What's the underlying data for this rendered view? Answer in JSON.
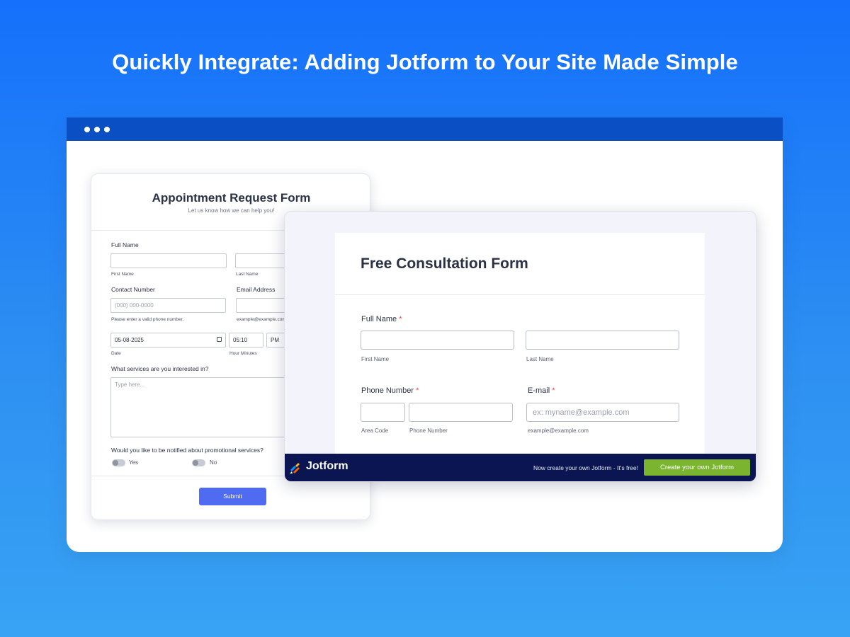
{
  "headline": "Quickly Integrate: Adding Jotform to Your Site Made Simple",
  "appointment_form": {
    "title": "Appointment Request Form",
    "subtitle": "Let us know how we can help you!",
    "full_name_label": "Full Name",
    "first_name_sub": "First Name",
    "last_name_sub": "Last Name",
    "contact_label": "Contact Number",
    "phone_placeholder": "(000) 000-0000",
    "phone_hint": "Please enter a valid phone number.",
    "email_label": "Email Address",
    "email_hint": "example@example.com",
    "date_value": "05-08-2025",
    "date_sub": "Date",
    "time_value": "05:10",
    "ampm_value": "PM",
    "time_sub": "Hour Minutes",
    "services_label": "What services are you interested in?",
    "services_placeholder": "Type here...",
    "promo_label": "Would you like to be notified about promotional services?",
    "yes_label": "Yes",
    "no_label": "No",
    "submit_label": "Submit"
  },
  "consultation_form": {
    "title": "Free Consultation Form",
    "full_name_label": "Full Name",
    "first_name_sub": "First Name",
    "last_name_sub": "Last Name",
    "phone_label": "Phone Number",
    "area_code_sub": "Area Code",
    "phone_number_sub": "Phone Number",
    "email_label": "E-mail",
    "email_placeholder": "ex: myname@example.com",
    "email_hint": "example@example.com",
    "required_mark": "*"
  },
  "footer": {
    "brand": "Jotform",
    "note": "Now create your own Jotform - It's free!",
    "cta": "Create your own Jotform"
  },
  "colors": {
    "background_top": "#1570fb",
    "browser_bar": "#0b4fc5",
    "footer_bg": "#0a1551",
    "cta_green": "#7bb52f",
    "submit_blue": "#4f6bf2",
    "required_red": "#e5484d"
  }
}
